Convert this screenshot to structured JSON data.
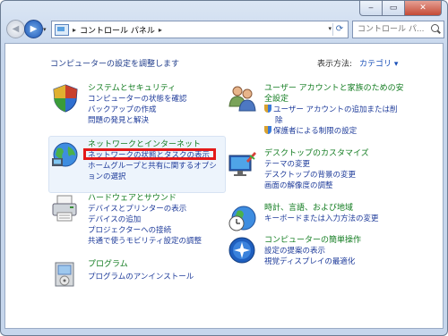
{
  "address": {
    "crumbs": [
      "コントロール パネル"
    ]
  },
  "search": {
    "placeholder": "コントロール パ..."
  },
  "content": {
    "heading": "コンピューターの設定を調整します",
    "view_by_label": "表示方法:",
    "view_by_value": "カテゴリ ▾"
  },
  "categories": {
    "system": {
      "title": "システムとセキュリティ",
      "links": [
        "コンピューターの状態を確認",
        "バックアップの作成",
        "問題の発見と解決"
      ]
    },
    "network": {
      "title": "ネットワークとインターネット",
      "links": [
        "ネットワークの状態とタスクの表示",
        "ホームグループと共有に関するオプシ",
        "ョンの選択"
      ]
    },
    "hardware": {
      "title": "ハードウェアとサウンド",
      "links": [
        "デバイスとプリンターの表示",
        "デバイスの追加",
        "プロジェクターへの接続",
        "共通で使うモビリティ設定の調整"
      ]
    },
    "programs": {
      "title": "プログラム",
      "links": [
        "プログラムのアンインストール"
      ]
    },
    "users": {
      "title_1": "ユーザー アカウントと家族のための安",
      "title_2": "全設定",
      "links": [
        "ユーザー アカウントの追加または削",
        "除",
        "保護者による制限の設定"
      ]
    },
    "appearance": {
      "title": "デスクトップのカスタマイズ",
      "links": [
        "テーマの変更",
        "デスクトップの背景の変更",
        "画面の解像度の調整"
      ]
    },
    "clock": {
      "title": "時計、言語、および地域",
      "links": [
        "キーボードまたは入力方法の変更"
      ]
    },
    "ease": {
      "title": "コンピューターの簡単操作",
      "links": [
        "設定の提案の表示",
        "視覚ディスプレイの最適化"
      ]
    }
  },
  "highlight_color": "#e31919"
}
